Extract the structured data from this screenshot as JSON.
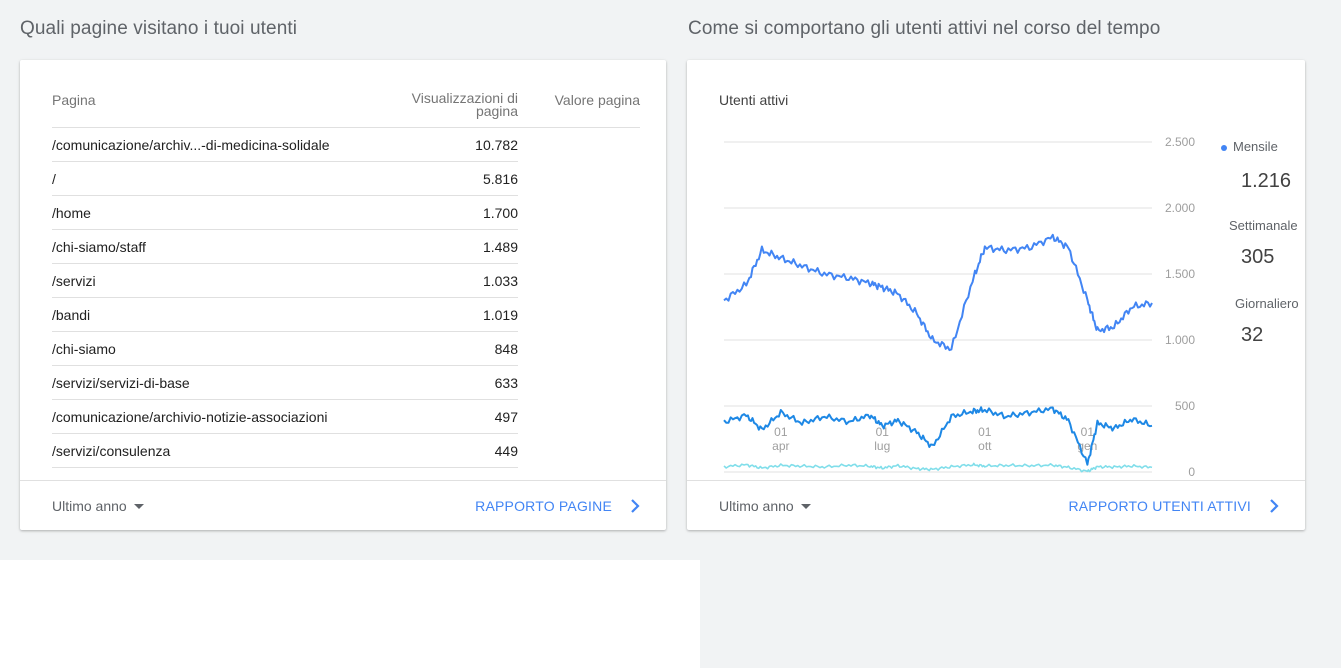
{
  "pages_section": {
    "title": "Quali pagine visitano i tuoi utenti",
    "col_page": "Pagina",
    "col_views": "Visualizzazioni di pagina",
    "col_value": "Valore pagina",
    "rows": [
      {
        "page": "/comunicazione/archiv...-di-medicina-solidale",
        "views": "10.782"
      },
      {
        "page": "/",
        "views": "5.816"
      },
      {
        "page": "/home",
        "views": "1.700"
      },
      {
        "page": "/chi-siamo/staff",
        "views": "1.489"
      },
      {
        "page": "/servizi",
        "views": "1.033"
      },
      {
        "page": "/bandi",
        "views": "1.019"
      },
      {
        "page": "/chi-siamo",
        "views": "848"
      },
      {
        "page": "/servizi/servizi-di-base",
        "views": "633"
      },
      {
        "page": "/comunicazione/archivio-notizie-associazioni",
        "views": "497"
      },
      {
        "page": "/servizi/consulenza",
        "views": "449"
      }
    ],
    "period": "Ultimo anno",
    "report_link": "RAPPORTO PAGINE"
  },
  "users_section": {
    "title": "Come si comportano gli utenti attivi nel corso del tempo",
    "chart_title": "Utenti attivi",
    "legend": [
      {
        "label": "Mensile",
        "value": "1.216",
        "color": "#4285f4"
      },
      {
        "label": "Settimanale",
        "value": "305",
        "color": "#1e88e5"
      },
      {
        "label": "Giornaliero",
        "value": "32",
        "color": "#80deea"
      }
    ],
    "period": "Ultimo anno",
    "report_link": "RAPPORTO UTENTI ATTIVI"
  },
  "icons": {
    "chevron": "chevron-right-icon",
    "dropdown": "caret-down-icon"
  },
  "chart_data": {
    "type": "line",
    "y_ticks": [
      "2.500",
      "2.000",
      "1.500",
      "1.000",
      "500",
      "0"
    ],
    "ylim": [
      0,
      2500
    ],
    "x_ticks": [
      {
        "day": "01",
        "month": "apr"
      },
      {
        "day": "01",
        "month": "lug"
      },
      {
        "day": "01",
        "month": "ott"
      },
      {
        "day": "01",
        "month": "gen"
      }
    ],
    "x": [
      "2016-02-10",
      "2016-03-01",
      "2016-03-15",
      "2016-04-01",
      "2016-04-20",
      "2016-05-10",
      "2016-06-01",
      "2016-06-20",
      "2016-07-01",
      "2016-07-15",
      "2016-08-01",
      "2016-08-15",
      "2016-09-01",
      "2016-09-20",
      "2016-10-01",
      "2016-10-20",
      "2016-11-10",
      "2016-12-01",
      "2016-12-15",
      "2017-01-01",
      "2017-01-10",
      "2017-01-25",
      "2017-02-10",
      "2017-02-28"
    ],
    "series": [
      {
        "name": "Mensile",
        "color": "#4285f4",
        "values": [
          1300,
          1420,
          1680,
          1620,
          1560,
          1500,
          1470,
          1430,
          1400,
          1350,
          1200,
          1000,
          930,
          1450,
          1700,
          1680,
          1700,
          1780,
          1700,
          1300,
          1070,
          1100,
          1250,
          1280
        ]
      },
      {
        "name": "Settimanale",
        "color": "#1e88e5",
        "values": [
          380,
          430,
          320,
          450,
          370,
          420,
          380,
          430,
          350,
          390,
          300,
          190,
          420,
          460,
          470,
          420,
          450,
          480,
          390,
          60,
          370,
          330,
          400,
          350
        ]
      },
      {
        "name": "Giornaliero",
        "color": "#80deea",
        "values": [
          40,
          55,
          30,
          50,
          45,
          38,
          52,
          44,
          30,
          48,
          25,
          20,
          40,
          55,
          45,
          50,
          48,
          52,
          35,
          5,
          40,
          38,
          45,
          35
        ]
      }
    ]
  }
}
